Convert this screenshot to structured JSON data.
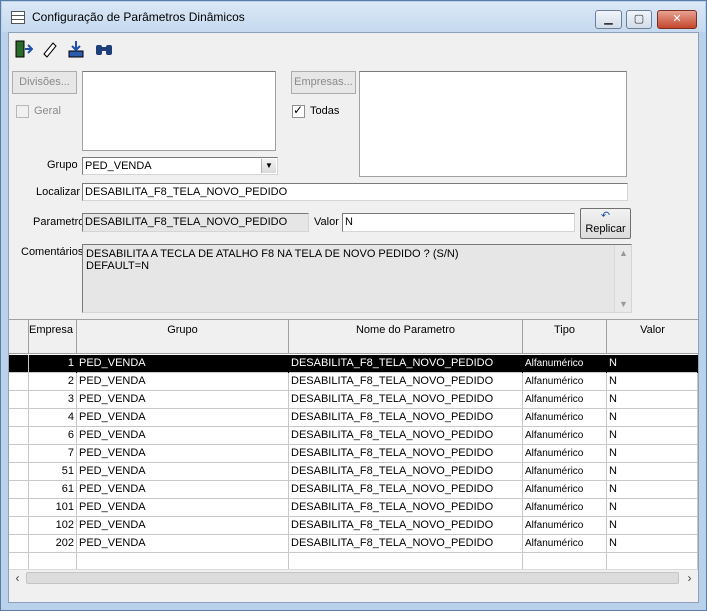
{
  "window": {
    "title": "Configuração de Parâmetros Dinâmicos",
    "buttons": {
      "minimize": "▁",
      "maximize": "▢",
      "close": "✕"
    }
  },
  "toolbar": {
    "icons": [
      "exit-door-icon",
      "eraser-icon",
      "save-download-icon",
      "binoculars-find-icon"
    ]
  },
  "filters": {
    "divisoes_button": "Divisões...",
    "geral_label": "Geral",
    "empresas_button": "Empresas...",
    "todas_label": "Todas",
    "todas_checked": "✓",
    "grupo_label": "Grupo",
    "grupo_value": "PED_VENDA",
    "localizar_label": "Localizar",
    "localizar_value": "DESABILITA_F8_TELA_NOVO_PEDIDO"
  },
  "details": {
    "parametro_label": "Parametro",
    "parametro_value": "DESABILITA_F8_TELA_NOVO_PEDIDO",
    "valor_label": "Valor",
    "valor_value": "N",
    "replicar_button": "Replicar",
    "comentarios_label": "Comentários",
    "comentarios_lines": [
      "DESABILITA A TECLA DE ATALHO F8 NA TELA DE NOVO PEDIDO ? (S/N)",
      "DEFAULT=N"
    ]
  },
  "grid": {
    "columns": [
      "Empresa",
      "Grupo",
      "Nome do Parametro",
      "Tipo",
      "Valor"
    ],
    "rows": [
      [
        "1",
        "PED_VENDA",
        "DESABILITA_F8_TELA_NOVO_PEDIDO",
        "Alfanumérico",
        "N"
      ],
      [
        "2",
        "PED_VENDA",
        "DESABILITA_F8_TELA_NOVO_PEDIDO",
        "Alfanumérico",
        "N"
      ],
      [
        "3",
        "PED_VENDA",
        "DESABILITA_F8_TELA_NOVO_PEDIDO",
        "Alfanumérico",
        "N"
      ],
      [
        "4",
        "PED_VENDA",
        "DESABILITA_F8_TELA_NOVO_PEDIDO",
        "Alfanumérico",
        "N"
      ],
      [
        "6",
        "PED_VENDA",
        "DESABILITA_F8_TELA_NOVO_PEDIDO",
        "Alfanumérico",
        "N"
      ],
      [
        "7",
        "PED_VENDA",
        "DESABILITA_F8_TELA_NOVO_PEDIDO",
        "Alfanumérico",
        "N"
      ],
      [
        "51",
        "PED_VENDA",
        "DESABILITA_F8_TELA_NOVO_PEDIDO",
        "Alfanumérico",
        "N"
      ],
      [
        "61",
        "PED_VENDA",
        "DESABILITA_F8_TELA_NOVO_PEDIDO",
        "Alfanumérico",
        "N"
      ],
      [
        "101",
        "PED_VENDA",
        "DESABILITA_F8_TELA_NOVO_PEDIDO",
        "Alfanumérico",
        "N"
      ],
      [
        "102",
        "PED_VENDA",
        "DESABILITA_F8_TELA_NOVO_PEDIDO",
        "Alfanumérico",
        "N"
      ],
      [
        "202",
        "PED_VENDA",
        "DESABILITA_F8_TELA_NOVO_PEDIDO",
        "Alfanumérico",
        "N"
      ]
    ],
    "selected_row": 0
  },
  "colors": {
    "title_bar": "#c5d9ef",
    "client_bg": "#f0f0f0",
    "selected_row": "#000000",
    "close_button": "#c5462c"
  }
}
